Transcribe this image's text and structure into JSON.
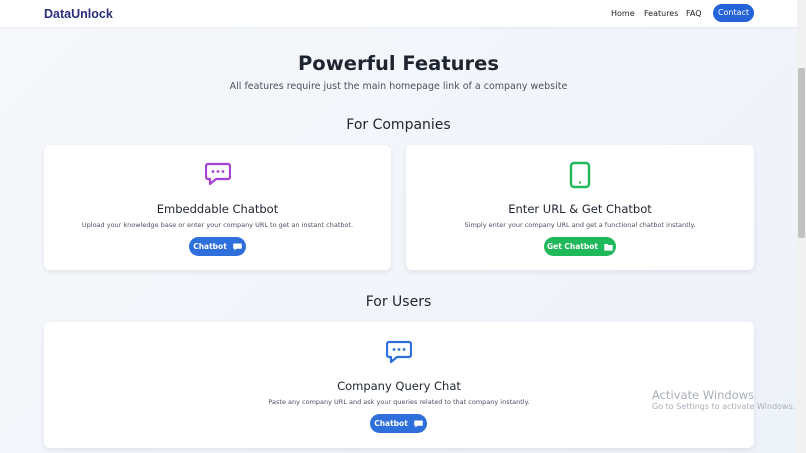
{
  "nav": {
    "brand": "DataUnlock",
    "links": [
      "Home",
      "Features",
      "FAQ"
    ],
    "contact": "Contact"
  },
  "hero": {
    "title": "Powerful Features",
    "subtitle": "All features require just the main homepage link of a company website"
  },
  "sections": [
    {
      "title": "For Companies",
      "cards": [
        {
          "icon": "chat-bubble-icon",
          "title": "Embeddable Chatbot",
          "desc": "Upload your knowledge base or enter your company URL to get an instant chatbot.",
          "button": "Chatbot",
          "button_icon": "comment-icon"
        },
        {
          "icon": "tablet-icon",
          "title": "Enter URL & Get Chatbot",
          "desc": "Simply enter your company URL and get a functional chatbot instantly.",
          "button": "Get Chatbot",
          "button_icon": "folder-icon"
        }
      ]
    },
    {
      "title": "For Users",
      "cards": [
        {
          "icon": "chat-bubble-icon",
          "title": "Company Query Chat",
          "desc": "Paste any company URL and ask your queries related to that company instantly.",
          "button": "Chatbot",
          "button_icon": "comment-icon"
        }
      ]
    }
  ],
  "watermark": {
    "line1": "Activate Windows",
    "line2": "Go to Settings to activate Windows."
  },
  "colors": {
    "brand": "#2c2f7a",
    "primary": "#2563d8",
    "button_blue": "#2f6fdb",
    "button_green": "#1fb85a",
    "icon_purple": "#a542d6",
    "icon_green": "#1fb85a",
    "icon_blue": "#2f6fdb"
  }
}
